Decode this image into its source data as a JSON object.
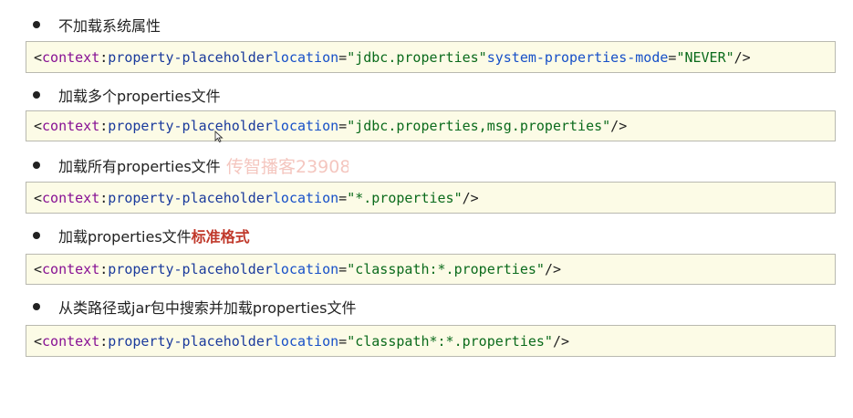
{
  "items": [
    {
      "text": "不加载系统属性",
      "emph": "",
      "code": {
        "ns": "context",
        "tag": "property-placeholder",
        "attrs": [
          {
            "name": "location",
            "value": "\"jdbc.properties\""
          },
          {
            "name": "system-properties-mode",
            "value": "\"NEVER\""
          }
        ]
      }
    },
    {
      "text": "加载多个properties文件",
      "emph": "",
      "code": {
        "ns": "context",
        "tag": "property-placeholder",
        "attrs": [
          {
            "name": "location",
            "value": "\"jdbc.properties,msg.properties\""
          }
        ]
      }
    },
    {
      "text": "加载所有properties文件",
      "emph": "",
      "code": {
        "ns": "context",
        "tag": "property-placeholder",
        "attrs": [
          {
            "name": "location",
            "value": "\"*.properties\""
          }
        ]
      }
    },
    {
      "text": "加载properties文件",
      "emph": "标准格式",
      "code": {
        "ns": "context",
        "tag": "property-placeholder",
        "attrs": [
          {
            "name": "location",
            "value": "\"classpath:*.properties\""
          }
        ]
      }
    },
    {
      "text": "从类路径或jar包中搜索并加载properties文件",
      "emph": "",
      "code": {
        "ns": "context",
        "tag": "property-placeholder",
        "attrs": [
          {
            "name": "location",
            "value": "\"classpath*:*.properties\""
          }
        ]
      }
    }
  ],
  "watermark": "传智播客23908",
  "colors": {
    "code_background": "#fcfbe6",
    "namespace": "#871094",
    "tag": "#1a3a9c",
    "attribute": "#1750c8",
    "value": "#0b6b1c",
    "emphasis": "#c0392b"
  }
}
